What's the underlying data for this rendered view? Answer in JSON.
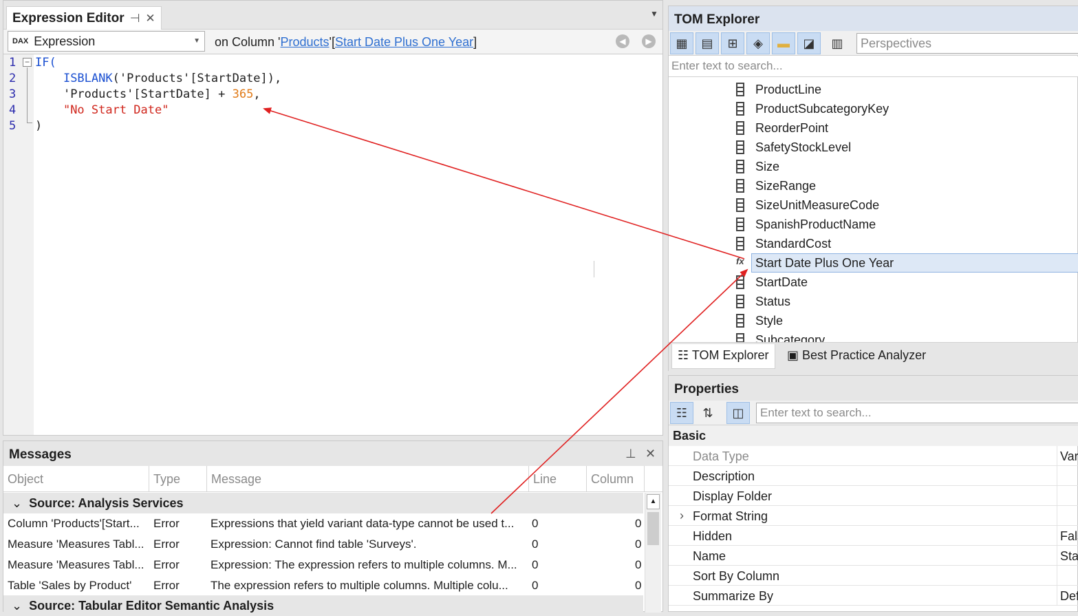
{
  "expression_editor": {
    "title": "Expression Editor",
    "language": "Expression",
    "language_badge": "DAX",
    "context_prefix": "on Column '",
    "context_table": "Products",
    "context_mid": "'[",
    "context_column": "Start Date Plus One Year",
    "context_suffix": "]",
    "line_numbers": [
      "1",
      "2",
      "3",
      "4",
      "5"
    ],
    "code": {
      "l1_kw": "IF(",
      "l2_fn": "ISBLANK",
      "l2_rest": "('Products'[StartDate]),",
      "l3_pre": "'Products'[StartDate] + ",
      "l3_num": "365",
      "l3_post": ",",
      "l4_str": "\"No Start Date\"",
      "l5": ")"
    }
  },
  "messages": {
    "title": "Messages",
    "columns": [
      "Object",
      "Type",
      "Message",
      "Line",
      "Column"
    ],
    "groups": [
      {
        "label": "Source: Analysis Services",
        "rows": [
          {
            "object": "Column 'Products'[Start...",
            "type": "Error",
            "message": "Expressions that yield variant data-type cannot be used t...",
            "line": "0",
            "column": "0"
          },
          {
            "object": "Measure 'Measures Tabl...",
            "type": "Error",
            "message": "Expression: Cannot find table 'Surveys'.",
            "line": "0",
            "column": "0"
          },
          {
            "object": "Measure 'Measures Tabl...",
            "type": "Error",
            "message": "Expression: The expression refers to multiple columns. M...",
            "line": "0",
            "column": "0"
          },
          {
            "object": "Table 'Sales by Product'",
            "type": "Error",
            "message": "The expression refers to multiple columns. Multiple colu...",
            "line": "0",
            "column": "0"
          }
        ]
      },
      {
        "label": "Source: Tabular Editor Semantic Analysis",
        "rows": []
      }
    ]
  },
  "tom_explorer": {
    "title": "TOM Explorer",
    "perspectives_placeholder": "Perspectives",
    "search_placeholder": "Enter text to search...",
    "items": [
      "ProductLine",
      "ProductSubcategoryKey",
      "ReorderPoint",
      "SafetyStockLevel",
      "Size",
      "SizeRange",
      "SizeUnitMeasureCode",
      "SpanishProductName",
      "StandardCost",
      "Start Date Plus One Year",
      "StartDate",
      "Status",
      "Style",
      "Subcategory"
    ],
    "selected_item": "Start Date Plus One Year",
    "bottom_tabs": [
      "TOM Explorer",
      "Best Practice Analyzer"
    ]
  },
  "properties": {
    "title": "Properties",
    "search_placeholder": "Enter text to search...",
    "category": "Basic",
    "rows": [
      {
        "name": "Data Type",
        "value": "Var"
      },
      {
        "name": "Description",
        "value": ""
      },
      {
        "name": "Display Folder",
        "value": ""
      },
      {
        "name": "Format String",
        "value": ""
      },
      {
        "name": "Hidden",
        "value": "Fals"
      },
      {
        "name": "Name",
        "value": "Star"
      },
      {
        "name": "Sort By Column",
        "value": ""
      },
      {
        "name": "Summarize By",
        "value": "Def"
      }
    ]
  },
  "colors": {
    "accent": "#2e6fd1",
    "arrow": "#e02020",
    "selection": "#dde8f6"
  }
}
